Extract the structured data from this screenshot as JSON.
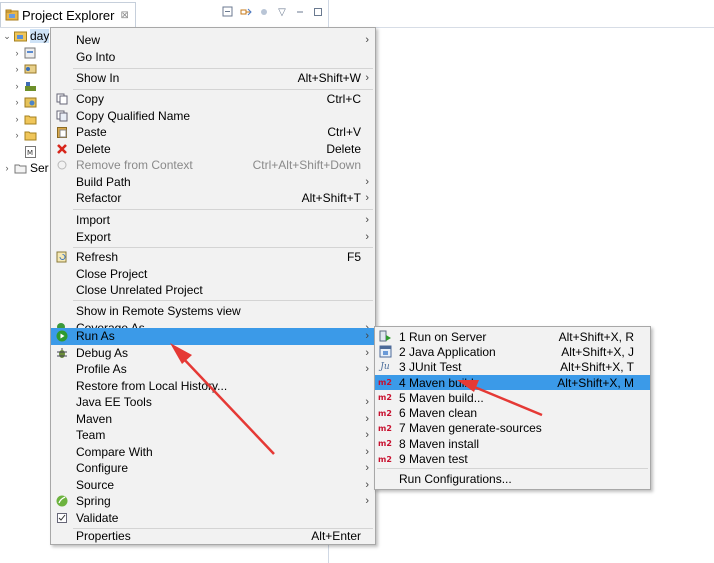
{
  "view": {
    "tab_title": "Project Explorer",
    "close_glyph": "⊠",
    "tree": [
      {
        "label": "day",
        "icon": "project-icon",
        "expanded": true,
        "selected": true
      },
      {
        "label": "",
        "icon": "deployment-descriptor-icon"
      },
      {
        "label": "",
        "icon": "jax-ws-icon"
      },
      {
        "label": "",
        "icon": "java-resources-icon"
      },
      {
        "label": "",
        "icon": "javascript-resources-icon"
      },
      {
        "label": "",
        "icon": "deployed-resources-icon"
      },
      {
        "label": "",
        "icon": "folder-icon"
      },
      {
        "label": "",
        "icon": "pom-file-icon"
      },
      {
        "label": "Ser",
        "icon": "servers-folder-icon"
      }
    ]
  },
  "context_menu": {
    "items": [
      {
        "label": "New",
        "accel": "",
        "submenu": true,
        "icon": ""
      },
      {
        "label": "Go Into",
        "accel": "",
        "submenu": false,
        "icon": ""
      },
      {
        "label": "Show In",
        "accel": "Alt+Shift+W",
        "submenu": true,
        "icon": ""
      },
      {
        "label": "Copy",
        "accel": "Ctrl+C",
        "submenu": false,
        "icon": "copy-icon"
      },
      {
        "label": "Copy Qualified Name",
        "accel": "",
        "submenu": false,
        "icon": "copy-qualified-icon"
      },
      {
        "label": "Paste",
        "accel": "Ctrl+V",
        "submenu": false,
        "icon": "paste-icon"
      },
      {
        "label": "Delete",
        "accel": "Delete",
        "submenu": false,
        "icon": "delete-icon"
      },
      {
        "label": "Remove from Context",
        "accel": "Ctrl+Alt+Shift+Down",
        "submenu": false,
        "icon": "remove-context-icon",
        "disabled": true
      },
      {
        "label": "Build Path",
        "accel": "",
        "submenu": true,
        "icon": ""
      },
      {
        "label": "Refactor",
        "accel": "Alt+Shift+T",
        "submenu": true,
        "icon": ""
      },
      {
        "label": "Import",
        "accel": "",
        "submenu": true,
        "icon": ""
      },
      {
        "label": "Export",
        "accel": "",
        "submenu": true,
        "icon": ""
      },
      {
        "label": "Refresh",
        "accel": "F5",
        "submenu": false,
        "icon": "refresh-icon"
      },
      {
        "label": "Close Project",
        "accel": "",
        "submenu": false,
        "icon": ""
      },
      {
        "label": "Close Unrelated Project",
        "accel": "",
        "submenu": false,
        "icon": ""
      },
      {
        "label": "Show in Remote Systems view",
        "accel": "",
        "submenu": false,
        "icon": ""
      },
      {
        "label": "Coverage As",
        "accel": "",
        "submenu": true,
        "icon": "coverage-icon"
      },
      {
        "label": "Run As",
        "accel": "",
        "submenu": true,
        "icon": "run-icon",
        "highlighted": true
      },
      {
        "label": "Debug As",
        "accel": "",
        "submenu": true,
        "icon": "debug-icon"
      },
      {
        "label": "Profile As",
        "accel": "",
        "submenu": true,
        "icon": ""
      },
      {
        "label": "Restore from Local History...",
        "accel": "",
        "submenu": false,
        "icon": ""
      },
      {
        "label": "Java EE Tools",
        "accel": "",
        "submenu": true,
        "icon": ""
      },
      {
        "label": "Maven",
        "accel": "",
        "submenu": true,
        "icon": ""
      },
      {
        "label": "Team",
        "accel": "",
        "submenu": true,
        "icon": ""
      },
      {
        "label": "Compare With",
        "accel": "",
        "submenu": true,
        "icon": ""
      },
      {
        "label": "Configure",
        "accel": "",
        "submenu": true,
        "icon": ""
      },
      {
        "label": "Source",
        "accel": "",
        "submenu": true,
        "icon": ""
      },
      {
        "label": "Spring",
        "accel": "",
        "submenu": true,
        "icon": "spring-icon"
      },
      {
        "label": "Validate",
        "accel": "",
        "submenu": false,
        "icon": "validate-icon"
      },
      {
        "label": "Properties",
        "accel": "Alt+Enter",
        "submenu": false,
        "icon": ""
      }
    ]
  },
  "run_as_menu": {
    "items": [
      {
        "label": "1 Run on Server",
        "accel": "Alt+Shift+X, R",
        "icon": "server-run-icon"
      },
      {
        "label": "2 Java Application",
        "accel": "Alt+Shift+X, J",
        "icon": "java-app-icon"
      },
      {
        "label": "3 JUnit Test",
        "accel": "Alt+Shift+X, T",
        "icon": "junit-icon"
      },
      {
        "label": "4 Maven build",
        "accel": "Alt+Shift+X, M",
        "icon": "maven-m2-icon",
        "highlighted": true
      },
      {
        "label": "5 Maven build...",
        "accel": "",
        "icon": "maven-m2-icon"
      },
      {
        "label": "6 Maven clean",
        "accel": "",
        "icon": "maven-m2-icon"
      },
      {
        "label": "7 Maven generate-sources",
        "accel": "",
        "icon": "maven-m2-icon"
      },
      {
        "label": "8 Maven install",
        "accel": "",
        "icon": "maven-m2-icon"
      },
      {
        "label": "9 Maven test",
        "accel": "",
        "icon": "maven-m2-icon"
      },
      {
        "label": "Run Configurations...",
        "accel": "",
        "icon": ""
      }
    ],
    "m2_label": "m2",
    "ju_label": "Ju"
  },
  "colors": {
    "highlight": "#3b9ae8",
    "menu_bg": "#f2f2f2",
    "annotation_arrow": "#e53935",
    "maven_red": "#c8102e"
  }
}
